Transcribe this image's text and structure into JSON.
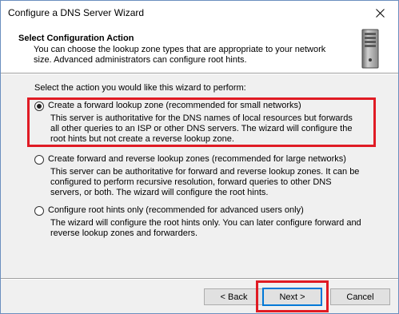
{
  "window": {
    "title": "Configure a DNS Server Wizard",
    "close_icon": "close-icon"
  },
  "header": {
    "title": "Select Configuration Action",
    "description": "You can choose the lookup zone types that are appropriate to your network size. Advanced administrators can configure root hints.",
    "icon": "server-icon"
  },
  "main": {
    "prompt": "Select the action you would like this wizard to perform:",
    "options": [
      {
        "label": "Create a forward lookup zone (recommended for small networks)",
        "description": "This server is authoritative for the DNS names of local resources but forwards all other queries to an ISP or other DNS servers. The wizard will configure the root hints but not create a reverse lookup zone.",
        "selected": true
      },
      {
        "label": "Create forward and reverse lookup zones (recommended for large networks)",
        "description": "This server can be authoritative for forward and reverse lookup zones. It can be configured to perform recursive resolution, forward queries to other DNS servers, or both. The wizard will configure the root hints.",
        "selected": false
      },
      {
        "label": "Configure root hints only (recommended for advanced users only)",
        "description": "The wizard will configure the root hints only. You can later configure forward and reverse lookup zones and forwarders.",
        "selected": false
      }
    ]
  },
  "footer": {
    "back_label": "< Back",
    "next_label": "Next >",
    "cancel_label": "Cancel"
  },
  "colors": {
    "highlight": "#e01b24",
    "focus_border": "#0078d7",
    "dialog_background": "#f0f0f0"
  }
}
